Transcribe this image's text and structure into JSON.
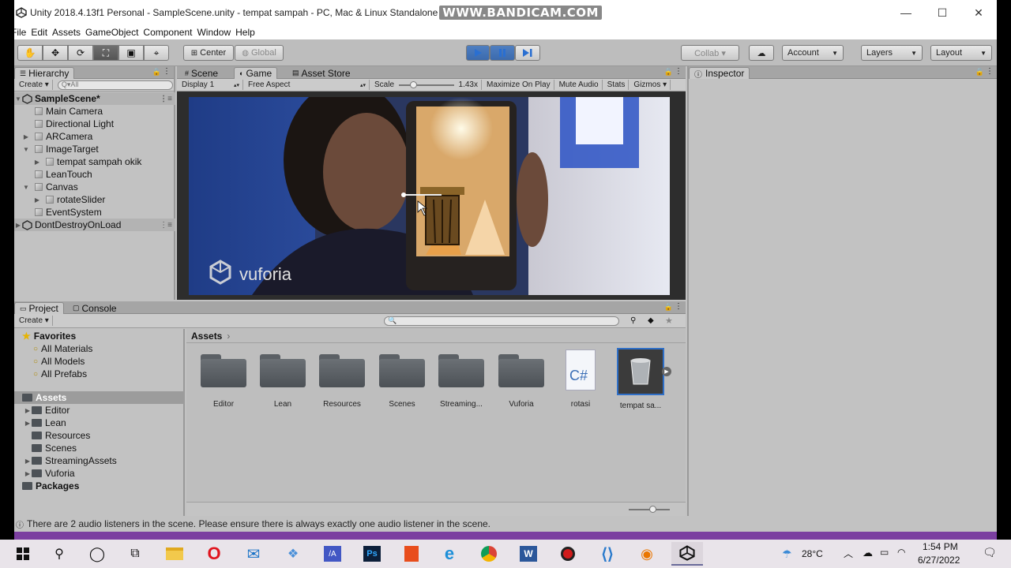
{
  "window": {
    "title": "Unity 2018.4.13f1 Personal - SampleScene.unity - tempat sampah - PC, Mac & Linux Standalone",
    "watermark": "WWW.BANDICAM.COM",
    "controls": {
      "minimize": "—",
      "maximize": "☐",
      "close": "✕"
    }
  },
  "menu": [
    "File",
    "Edit",
    "Assets",
    "GameObject",
    "Component",
    "Window",
    "Help"
  ],
  "toolbar": {
    "pivot": "Center",
    "space": "Global",
    "collab": "Collab ▾",
    "account": "Account",
    "layers": "Layers",
    "layout": "Layout"
  },
  "hierarchy": {
    "tab": "Hierarchy",
    "create": "Create ▾",
    "search_placeholder": "Q▾All",
    "rows": [
      {
        "label": "SampleScene*",
        "bold": true
      },
      {
        "label": "Main Camera"
      },
      {
        "label": "Directional Light"
      },
      {
        "label": "ARCamera"
      },
      {
        "label": "ImageTarget"
      },
      {
        "label": "tempat sampah okik"
      },
      {
        "label": "LeanTouch"
      },
      {
        "label": "Canvas"
      },
      {
        "label": "rotateSlider"
      },
      {
        "label": "EventSystem"
      },
      {
        "label": "DontDestroyOnLoad"
      }
    ]
  },
  "center_tabs": {
    "scene": "Scene",
    "game": "Game",
    "asset_store": "Asset Store"
  },
  "game_bar": {
    "display": "Display 1",
    "aspect": "Free Aspect",
    "scale_label": "Scale",
    "scale_value": "1.43x",
    "scale_fraction": 0.25,
    "maximize": "Maximize On Play",
    "mute": "Mute Audio",
    "stats": "Stats",
    "gizmos": "Gizmos ▾"
  },
  "game_view": {
    "logo_text": "vuforia"
  },
  "inspector": {
    "tab": "Inspector"
  },
  "project": {
    "tab": "Project",
    "console_tab": "Console",
    "create": "Create ▾",
    "breadcrumb": "Assets",
    "tree": [
      {
        "label": "Favorites",
        "bold": true
      },
      {
        "label": "All Materials"
      },
      {
        "label": "All Models"
      },
      {
        "label": "All Prefabs"
      },
      {
        "label": "Assets",
        "bold": true
      },
      {
        "label": "Editor"
      },
      {
        "label": "Lean"
      },
      {
        "label": "Resources"
      },
      {
        "label": "Scenes"
      },
      {
        "label": "StreamingAssets"
      },
      {
        "label": "Vuforia"
      },
      {
        "label": "Packages",
        "bold": true
      }
    ],
    "assets": [
      {
        "label": "Editor"
      },
      {
        "label": "Lean"
      },
      {
        "label": "Resources"
      },
      {
        "label": "Scenes"
      },
      {
        "label": "Streaming..."
      },
      {
        "label": "Vuforia"
      },
      {
        "label": "rotasi",
        "glyph": "C#"
      },
      {
        "label": "tempat sa..."
      }
    ]
  },
  "status": {
    "message": "There are 2 audio listeners in the scene. Please ensure there is always exactly one audio listener in the scene."
  },
  "taskbar": {
    "temperature": "28°C",
    "time": "1:54 PM",
    "date": "6/27/2022"
  }
}
